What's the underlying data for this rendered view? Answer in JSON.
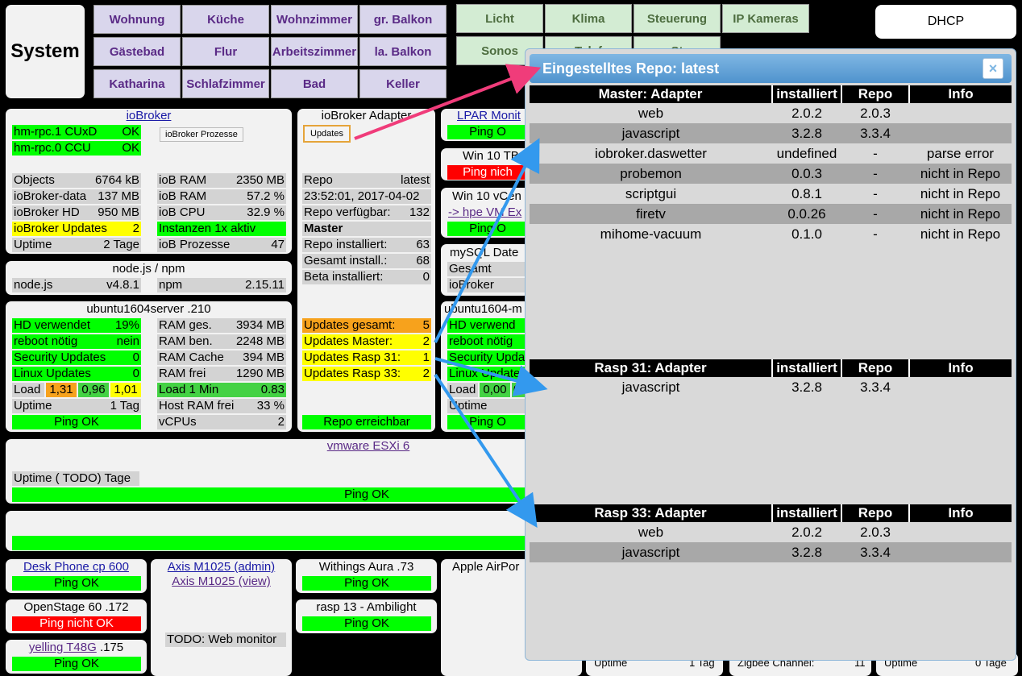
{
  "system_label": "System",
  "dhcp_label": "DHCP",
  "rooms": [
    "Wohnung",
    "Küche",
    "Wohnzimmer",
    "gr. Balkon",
    "Gästebad",
    "Flur",
    "Arbeitszimmer",
    "la. Balkon",
    "Katharina",
    "Schlafzimmer",
    "Bad",
    "Keller"
  ],
  "functions": [
    "Licht",
    "Klima",
    "Steuerung",
    "IP Kameras",
    "Sonos",
    "Telef",
    "St"
  ],
  "iobroker": {
    "title": "ioBroker",
    "rpc1_label": "hm-rpc.1 CUxD",
    "rpc1_value": "OK",
    "rpc0_label": "hm-rpc.0 CCU",
    "rpc0_value": "OK",
    "proc_button": "ioBroker Prozesse",
    "objects_label": "Objects",
    "objects_value": "6764 kB",
    "data_label": "ioBroker-data",
    "data_value": "137 MB",
    "hd_label": "ioBroker HD",
    "hd_value": "950 MB",
    "updates_label": "ioBroker Updates",
    "updates_value": "2",
    "uptime_label": "Uptime",
    "uptime_value": "2 Tage",
    "ram1_label": "ioB RAM",
    "ram1_value": "2350 MB",
    "ram2_label": "ioB RAM",
    "ram2_value": "57.2 %",
    "cpu_label": "ioB CPU",
    "cpu_value": "32.9 %",
    "instances_label": "Instanzen 1x aktiv",
    "procs_label": "ioB Prozesse",
    "procs_value": "47"
  },
  "node": {
    "title": "node.js / npm",
    "node_label": "node.js",
    "node_value": "v4.8.1",
    "npm_label": "npm",
    "npm_value": "2.15.11"
  },
  "ubuntu": {
    "title": "ubuntu1604server .210",
    "hd_label": "HD verwendet",
    "hd_value": "19%",
    "reboot_label": "reboot nötig",
    "reboot_value": "nein",
    "sec_label": "Security Updates",
    "sec_value": "0",
    "lin_label": "Linux Updates",
    "lin_value": "0",
    "load_label": "Load",
    "load1": "1,31",
    "load2": "0,96",
    "load3": "1,01",
    "uptime_label": "Uptime",
    "uptime_value": "1 Tag",
    "ping": "Ping OK",
    "ramges_label": "RAM ges.",
    "ramges_value": "3934 MB",
    "ramben_label": "RAM ben.",
    "ramben_value": "2248 MB",
    "cache_label": "RAM Cache",
    "cache_value": "394 MB",
    "ramfrei_label": "RAM frei",
    "ramfrei_value": "1290 MB",
    "load1min_label": "Load 1 Min",
    "load1min_value": "0.83",
    "hostram_label": "Host RAM frei",
    "hostram_value": "33 %",
    "vcpu_label": "vCPUs",
    "vcpu_value": "2"
  },
  "adapter": {
    "title": "ioBroker Adapter",
    "updates_button": "Updates",
    "repo_label": "Repo",
    "repo_value": "latest",
    "timestamp": "23:52:01, 2017-04-02",
    "verf_label": "Repo verfügbar:",
    "verf_value": "132",
    "master": "Master",
    "inst_label": "Repo installiert:",
    "inst_value": "63",
    "gesamt_label": "Gesamt install.:",
    "gesamt_value": "68",
    "beta_label": "Beta installiert:",
    "beta_value": "0",
    "upd_total_label": "Updates gesamt:",
    "upd_total_value": "5",
    "upd_master_label": "Updates Master:",
    "upd_master_value": "2",
    "upd_r31_label": "Updates Rasp 31:",
    "upd_r31_value": "1",
    "upd_r33_label": "Updates Rasp 33:",
    "upd_r33_value": "2",
    "repo_ok": "Repo erreichbar"
  },
  "col4": {
    "lpar": "LPAR Monit",
    "ping1": "Ping O",
    "win10tb": "Win 10 TB",
    "ping_not": "Ping nich",
    "win10vc": "Win 10 vCen",
    "hpe": "-> hpe VM Ex",
    "ping2": "Ping O",
    "mysql": "mySQL Date",
    "gesamt": "Gesamt",
    "iobroker": "ioBroker",
    "ubuntu_m": "ubuntu1604-m",
    "hd": "HD verwend",
    "reboot": "reboot nötig",
    "sec": "Security Upda",
    "lin": "Linux Update",
    "load": "Load",
    "load1": "0,00",
    "load2": "0",
    "uptime": "Uptime",
    "ping3": "Ping O"
  },
  "vmware": {
    "title": "vmware ESXi 6",
    "uptime": "Uptime ( TODO) Tage",
    "ping": "Ping OK"
  },
  "bottom": {
    "desk": "Desk Phone cp 600",
    "desk_ping": "Ping OK",
    "openstage": "OpenStage 60 .172",
    "openstage_ping": "Ping nicht OK",
    "yelling": "yelling T48G",
    "yelling_ip": ".175",
    "yelling_ping": "Ping OK",
    "axis_admin": "Axis M1025 (admin)",
    "axis_view": "Axis M1025 (view)",
    "todo": "TODO: Web monitor",
    "withings": "Withings Aura .73",
    "withings_ping": "Ping OK",
    "rasp13": "rasp 13 - Ambilight",
    "rasp13_ping": "Ping OK",
    "apple": "Apple AirPor",
    "uptime_a": "Uptime",
    "tag_a": "1 Tag",
    "zigbee": "Zigbee Channel:",
    "zigbee_v": "11",
    "uptime_b": "Uptime",
    "tag_b": "0 Tage"
  },
  "dialog": {
    "title": "Eingestelltes Repo: latest",
    "close": "×",
    "headers": {
      "installed": "installiert",
      "repo": "Repo",
      "info": "Info"
    },
    "master_title": "Master: Adapter",
    "master_rows": [
      [
        "web",
        "2.0.2",
        "2.0.3",
        ""
      ],
      [
        "javascript",
        "3.2.8",
        "3.3.4",
        ""
      ],
      [
        "iobroker.daswetter",
        "undefined",
        "-",
        "parse error"
      ],
      [
        "probemon",
        "0.0.3",
        "-",
        "nicht in Repo"
      ],
      [
        "scriptgui",
        "0.8.1",
        "-",
        "nicht in Repo"
      ],
      [
        "firetv",
        "0.0.26",
        "-",
        "nicht in Repo"
      ],
      [
        "mihome-vacuum",
        "0.1.0",
        "-",
        "nicht in Repo"
      ]
    ],
    "r31_title": "Rasp 31: Adapter",
    "r31_rows": [
      [
        "javascript",
        "3.2.8",
        "3.3.4",
        ""
      ]
    ],
    "r33_title": "Rasp 33: Adapter",
    "r33_rows": [
      [
        "web",
        "2.0.2",
        "2.0.3",
        ""
      ],
      [
        "javascript",
        "3.2.8",
        "3.3.4",
        ""
      ]
    ]
  },
  "colors": {
    "ok_green": "#00ff00",
    "warn_yellow": "#ffff00",
    "alert_red": "#ff0000",
    "orange": "#f7a21c",
    "dialog_blue": "#5a9bd5",
    "arrow_pink": "#f03c7a",
    "arrow_blue": "#3399ee"
  }
}
